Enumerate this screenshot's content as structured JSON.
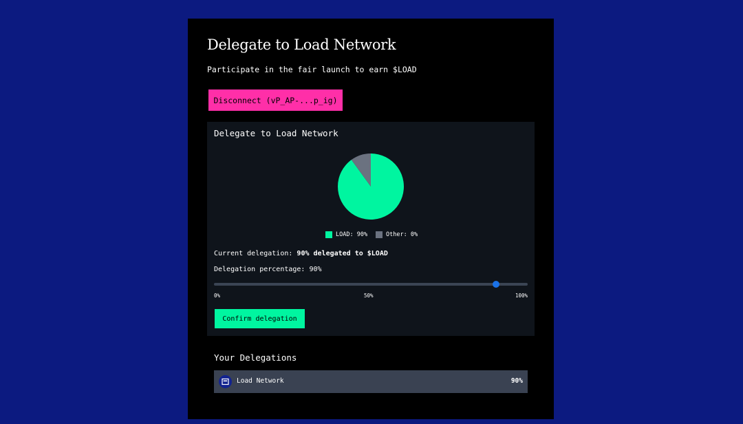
{
  "header": {
    "title": "Delegate to Load Network",
    "subtitle": "Participate in the fair launch to earn $LOAD",
    "disconnect_label": "Disconnect (vP_AP-...p_ig)"
  },
  "delegation_card": {
    "title": "Delegate to Load Network",
    "current_prefix": "Current delegation: ",
    "current_value": "90% delegated to $LOAD",
    "percentage_label": "Delegation percentage: 90%",
    "slider": {
      "value_percent": 90,
      "tick_labels": [
        "0%",
        "50%",
        "100%"
      ]
    },
    "confirm_label": "Confirm delegation"
  },
  "chart_data": {
    "type": "pie",
    "slices": [
      {
        "label": "LOAD",
        "value": 90,
        "color": "#00f5a0"
      },
      {
        "label": "Other",
        "value": 10,
        "color": "#6b7280"
      }
    ],
    "legend": [
      "LOAD: 90%",
      "Other: 0%"
    ],
    "legend_placement": "bottom"
  },
  "your_delegations": {
    "title": "Your Delegations",
    "items": [
      {
        "name": "Load Network",
        "percent": "90%",
        "icon": "network-icon"
      }
    ]
  },
  "colors": {
    "background": "#0c1a80",
    "panel": "#000000",
    "card": "#0f141b",
    "accent_pink": "#ff2fa8",
    "accent_green": "#00f5a0",
    "slider_thumb": "#1a72e8"
  }
}
